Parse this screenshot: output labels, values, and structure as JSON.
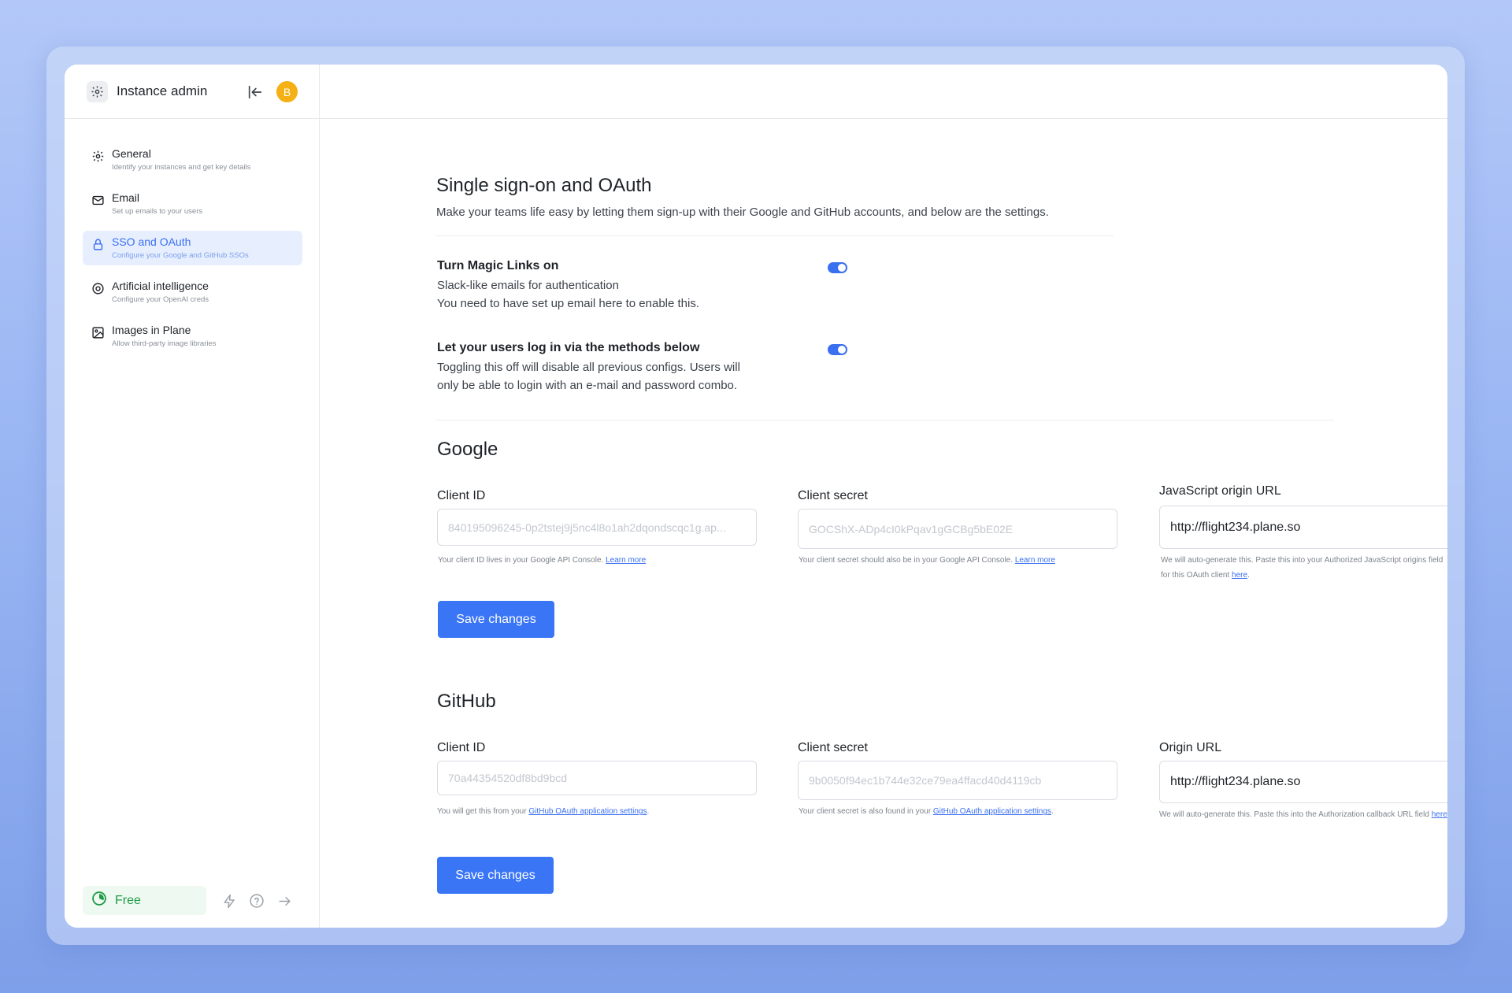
{
  "colors": {
    "accent": "#3a75f6",
    "active_nav_bg": "#e7efff",
    "avatar": "#f5b014",
    "free_badge": "#1f9a47"
  },
  "sidebar": {
    "title": "Instance admin",
    "avatar_initial": "B",
    "items": [
      {
        "label": "General",
        "description": "Identify your instances and get key details",
        "icon": "gear-icon",
        "active": false
      },
      {
        "label": "Email",
        "description": "Set up emails to your users",
        "icon": "mail-icon",
        "active": false
      },
      {
        "label": "SSO and OAuth",
        "description": "Configure your Google and GitHub SSOs",
        "icon": "lock-icon",
        "active": true
      },
      {
        "label": "Artificial intelligence",
        "description": "Configure your OpenAI creds",
        "icon": "brain-icon",
        "active": false
      },
      {
        "label": "Images in Plane",
        "description": "Allow third-party image libraries",
        "icon": "image-icon",
        "active": false
      }
    ],
    "plan": "Free"
  },
  "page": {
    "title": "Single sign-on and OAuth",
    "subtitle": "Make your teams life easy by letting them sign-up with their Google and GitHub accounts, and below are the settings."
  },
  "options": {
    "magic_links": {
      "title": "Turn Magic Links on",
      "desc_line1": "Slack-like emails for authentication",
      "desc_line2": "You need to have set up email here to enable this.",
      "enabled": true
    },
    "login_methods": {
      "title": "Let your users log in via the methods below",
      "desc_line1": "Toggling this off will disable all previous configs. Users will",
      "desc_line2": "only be able to login with an e-mail and password combo.",
      "enabled": true
    }
  },
  "google": {
    "title": "Google",
    "client_id_label": "Client ID",
    "client_id_placeholder": "840195096245-0p2tstej9j5nc4l8o1ah2dqondscqc1g.ap...",
    "client_id_hint": "Your client ID lives in your Google API Console.",
    "client_id_link": "Learn more",
    "client_secret_label": "Client secret",
    "client_secret_placeholder": "GOCShX-ADp4cI0kPqav1gGCBg5bE02E",
    "client_secret_hint": "Your client secret should also be in your Google API Console.",
    "client_secret_link": "Learn more",
    "origin_label": "JavaScript origin URL",
    "origin_value": "http://flight234.plane.so",
    "origin_hint_line1": "We will auto-generate this. Paste this into your Authorized JavaScript origins field",
    "origin_hint_line2": "for this OAuth client",
    "origin_link": "here",
    "save_label": "Save changes"
  },
  "github": {
    "title": "GitHub",
    "client_id_label": "Client ID",
    "client_id_placeholder": "70a44354520df8bd9bcd",
    "client_id_hint": "You will get this from your",
    "client_id_link": "GitHub OAuth application settings",
    "client_secret_label": "Client secret",
    "client_secret_placeholder": "9b0050f94ec1b744e32ce79ea4ffacd40d4119cb",
    "client_secret_hint": "Your client secret is also found in your",
    "client_secret_link": "GitHub OAuth application settings",
    "origin_label": "Origin URL",
    "origin_value": "http://flight234.plane.so",
    "origin_hint": "We will auto-generate this. Paste this into the Authorization callback URL field",
    "origin_link": "here",
    "save_label": "Save changes"
  }
}
